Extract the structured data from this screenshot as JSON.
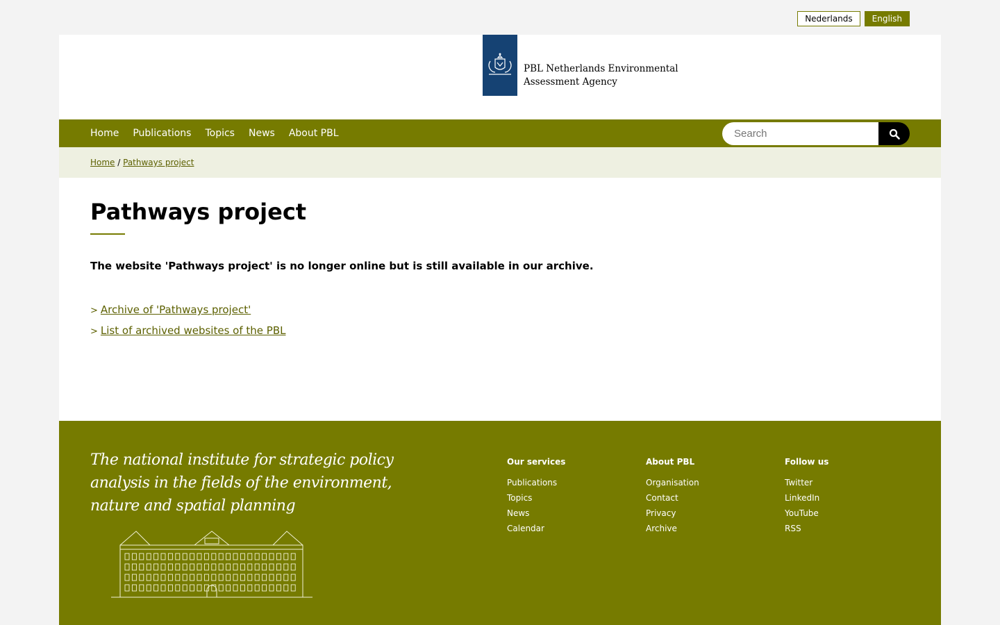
{
  "language": {
    "nl": "Nederlands",
    "en": "English"
  },
  "header": {
    "org_line1": "PBL Netherlands Environmental",
    "org_line2": "Assessment Agency"
  },
  "nav": {
    "items": [
      "Home",
      "Publications",
      "Topics",
      "News",
      "About PBL"
    ]
  },
  "search": {
    "placeholder": "Search"
  },
  "breadcrumb": {
    "home": "Home",
    "current": "Pathways project"
  },
  "main": {
    "title": "Pathways project",
    "lead": "The website 'Pathways project' is no longer online but is still available in our archive.",
    "links": [
      "Archive of 'Pathways project'",
      "List of archived websites of the PBL"
    ],
    "link_prefix": ">"
  },
  "footer": {
    "tagline": "The national institute for strategic policy analysis in the fields of the environment, nature and spatial planning",
    "columns": [
      {
        "heading": "Our services",
        "items": [
          "Publications",
          "Topics",
          "News",
          "Calendar"
        ]
      },
      {
        "heading": "About PBL",
        "items": [
          "Organisation",
          "Contact",
          "Privacy",
          "Archive"
        ]
      },
      {
        "heading": "Follow us",
        "items": [
          "Twitter",
          "LinkedIn",
          "YouTube",
          "RSS"
        ]
      }
    ]
  },
  "colors": {
    "accent": "#767b00",
    "logo_blue": "#154273",
    "breadcrumb_bg": "#eef0e1"
  }
}
